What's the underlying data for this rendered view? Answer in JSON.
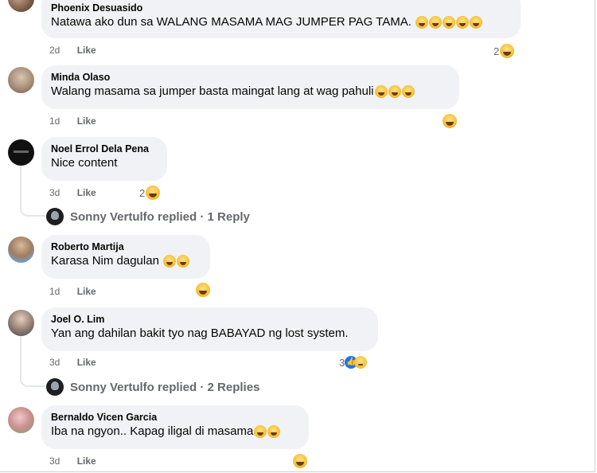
{
  "comments": [
    {
      "author": "Phoenix Desuasido",
      "text": "Natawa ako dun sa WALANG MASAMA MAG JUMPER PAG TAMA.",
      "time": "2d",
      "like": "Like",
      "reaction_count": "2"
    },
    {
      "author": "Minda Olaso",
      "text": "Walang masama sa jumper basta maingat lang at wag pahuli",
      "time": "1d",
      "like": "Like"
    },
    {
      "author": "Noel Errol Dela Pena",
      "text": "Nice content",
      "time": "3d",
      "like": "Like",
      "reaction_count": "2",
      "reply_summary": "Sonny Vertulfo replied · 1 Reply"
    },
    {
      "author": "Roberto Martija",
      "text": "Karasa Nim dagulan",
      "time": "1d",
      "like": "Like"
    },
    {
      "author": "Joel O. Lim",
      "text": "Yan ang dahilan bakit tyo nag BABAYAD ng lost system.",
      "time": "3d",
      "like": "Like",
      "reaction_count": "3",
      "reply_summary": "Sonny Vertulfo replied · 2 Replies"
    },
    {
      "author": "Bernaldo Vicen Garcia",
      "text": "Iba na ngyon.. Kapag iligal di masama",
      "time": "3d",
      "like": "Like"
    }
  ],
  "colors": {
    "bubble": "#f0f2f5",
    "meta_text": "#65676b",
    "like_reaction": "#1877f2"
  },
  "icons": [
    "laughing-emoji-icon",
    "like-reaction-icon",
    "sad-reaction-icon"
  ]
}
